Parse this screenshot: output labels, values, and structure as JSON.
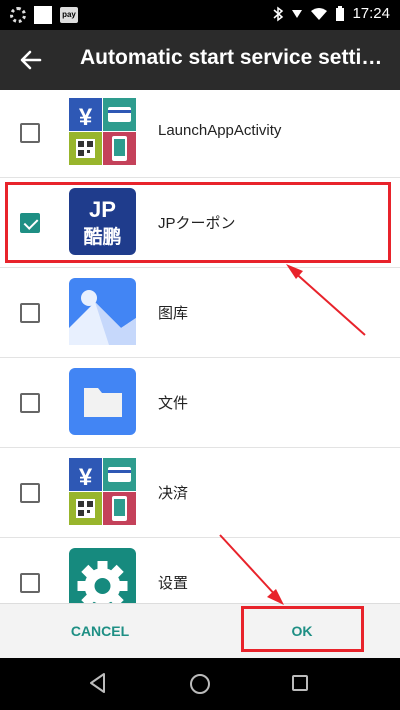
{
  "status_bar": {
    "time": "17:24",
    "pay_label": "pay"
  },
  "toolbar": {
    "title": "Automatic start service settings"
  },
  "apps": [
    {
      "label": "LaunchAppActivity",
      "checked": false,
      "icon": "wallet-app-icon"
    },
    {
      "label": "JPクーポン",
      "checked": true,
      "icon": "jp-coupon-app-icon",
      "icon_text_top": "JP",
      "icon_text_bottom": "酷鹏"
    },
    {
      "label": "图库",
      "checked": false,
      "icon": "gallery-app-icon"
    },
    {
      "label": "文件",
      "checked": false,
      "icon": "files-app-icon"
    },
    {
      "label": "决済",
      "checked": false,
      "icon": "wallet-app-icon"
    },
    {
      "label": "设置",
      "checked": false,
      "icon": "settings-app-icon"
    }
  ],
  "buttons": {
    "cancel": "CANCEL",
    "ok": "OK"
  },
  "colors": {
    "accent": "#1e8f84",
    "toolbar": "#2b2b2b",
    "annotation": "#e8232b",
    "jp_icon_bg": "#1f3c8c"
  }
}
